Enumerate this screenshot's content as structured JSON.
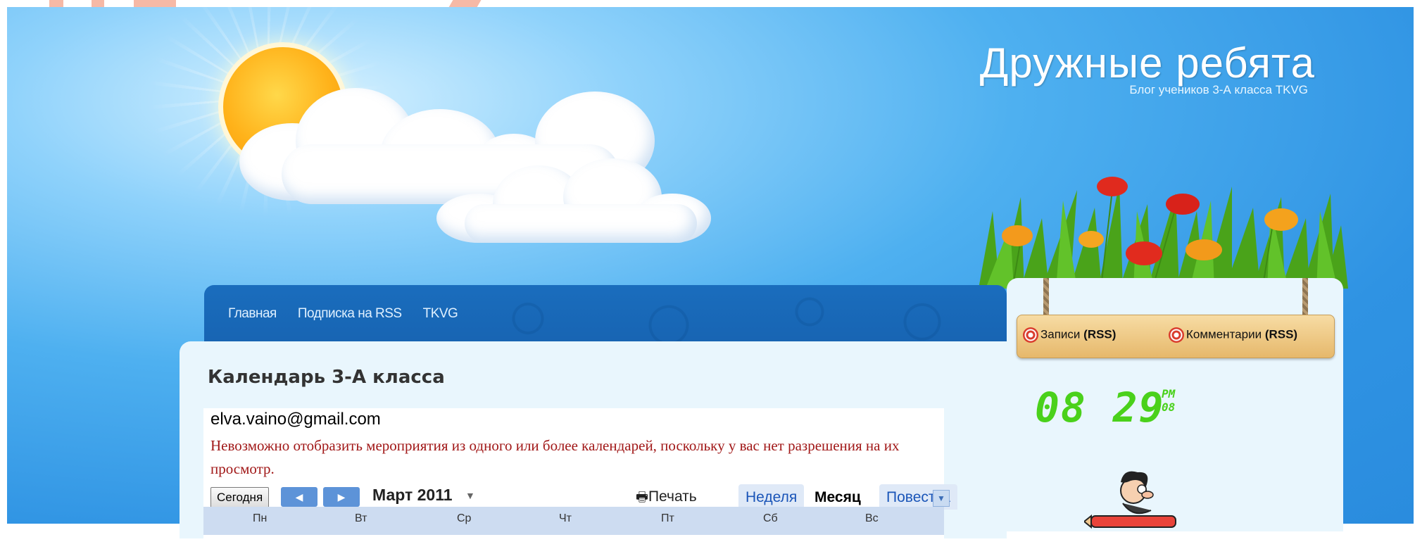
{
  "header": {
    "title": "Дружные ребята",
    "subtitle": "Блог учеников 3-А класса TKVG"
  },
  "nav": {
    "items": [
      {
        "label": "Главная"
      },
      {
        "label": "Подписка на RSS"
      },
      {
        "label": "TKVG"
      }
    ]
  },
  "post": {
    "title": "Календарь 3-А класса"
  },
  "calendar": {
    "email": "elva.vaino@gmail.com",
    "error": "Невозможно отобразить мероприятия из одного или более календарей, поскольку у вас нет разрешения на их просмотр.",
    "today_label": "Сегодня",
    "month": "Март 2011",
    "print_label": "Печать",
    "tabs": {
      "week": "Неделя",
      "month": "Месяц",
      "agenda": "Повестка дня"
    },
    "active_tab": "Месяц",
    "day_headers": [
      "Пн",
      "Вт",
      "Ср",
      "Чт",
      "Пт",
      "Сб",
      "Вс"
    ]
  },
  "sidebar": {
    "rss": [
      {
        "label": "Записи",
        "tag": "(RSS)"
      },
      {
        "label": "Комментарии",
        "tag": "(RSS)"
      }
    ],
    "clock": {
      "time": "08 29",
      "ampm": "PM",
      "seconds": "08"
    }
  },
  "icons": {
    "print": "printer-icon",
    "rss": "rss-icon",
    "prev": "arrow-left-icon",
    "next": "arrow-right-icon",
    "dropdown": "chevron-down-icon"
  },
  "colors": {
    "sky": "#2f93e3",
    "nav": "#1763b1",
    "error_text": "#a11818",
    "clock": "#4ad11b",
    "tab_link": "#1a55b8"
  }
}
